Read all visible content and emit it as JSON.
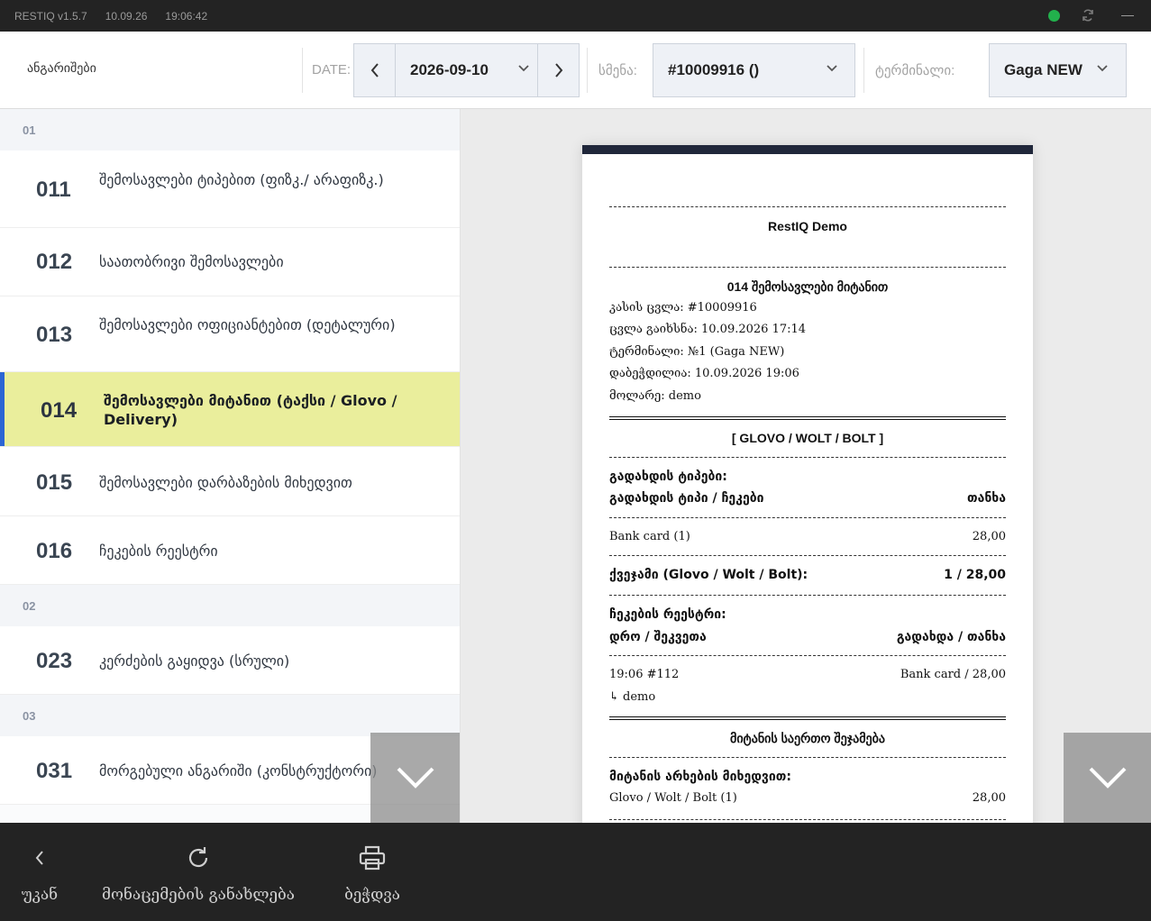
{
  "topbar": {
    "app_version": "RESTIQ v1.5.7",
    "date": "10.09.26",
    "time": "19:06:42",
    "status_color": "#22b14c"
  },
  "header": {
    "title": "ანგარიშები",
    "date_label": "DATE:",
    "date_value": "2026-09-10",
    "shift_label": "სმენა:",
    "shift_value": "#10009916 ()",
    "terminal_label": "ტერმინალი:",
    "terminal_value": "Gaga NEW"
  },
  "reports": {
    "sections": [
      "01",
      "02",
      "03"
    ],
    "items": [
      {
        "code": "011",
        "name": "შემოსავლები ტიპებით (ფიზკ./ არაფიზკ.)"
      },
      {
        "code": "012",
        "name": "საათობრივი შემოსავლები"
      },
      {
        "code": "013",
        "name": "შემოსავლები ოფიციანტებით (დეტალური)"
      },
      {
        "code": "014",
        "name": "შემოსავლები მიტანით (ტაქსი / Glovo / Delivery)"
      },
      {
        "code": "015",
        "name": "შემოსავლები დარბაზების მიხედვით"
      },
      {
        "code": "016",
        "name": "ჩეკების რეესტრი"
      },
      {
        "code": "023",
        "name": "კერძების გაყიდვა (სრული)"
      },
      {
        "code": "031",
        "name": "მორგებული ანგარიში (კონსტრუქტორი)"
      }
    ],
    "active_code": "014",
    "accent_color": "#2c66d4",
    "active_bg": "#eaee9c"
  },
  "receipt": {
    "company": "RestIQ Demo",
    "report_title": "014 შემოსავლები მიტანით",
    "info": {
      "shift": "კასის ცვლა: #10009916",
      "opened": "ცვლა გაიხსნა: 10.09.2026 17:14",
      "terminal": "ტერმინალი: №1 (Gaga NEW)",
      "printed": "დაბეჭდილია: 10.09.2026 19:06",
      "cashier": "მოლარე: demo"
    },
    "group_title": "[ GLOVO / WOLT / BOLT ]",
    "payment_types_label": "გადახდის ტიპები:",
    "payment_header_left": "გადახდის ტიპი / ჩეკები",
    "payment_header_right": "თანხა",
    "payment_row_left": "Bank card (1)",
    "payment_row_right": "28,00",
    "subtotal_left": "ქვეჯამი (Glovo / Wolt / Bolt):",
    "subtotal_right": "1 / 28,00",
    "checks_label": "ჩეკების რეესტრი:",
    "checks_header_left": "დრო / შეკვეთა",
    "checks_header_right": "გადახდა / თანხა",
    "check_row_left": "19:06 #112",
    "check_row_right": "Bank card / 28,00",
    "check_row_sub": "↳ demo",
    "summary_title": "მიტანის საერთო შეჯამება",
    "channels_label": "მიტანის არხების მიხედვით:",
    "channel_row_left": "Glovo / Wolt / Bolt (1)",
    "channel_row_right": "28,00"
  },
  "bottom": {
    "back_label": "უკან",
    "refresh_label": "მონაცემების განახლება",
    "print_label": "ბეჭდვა"
  }
}
